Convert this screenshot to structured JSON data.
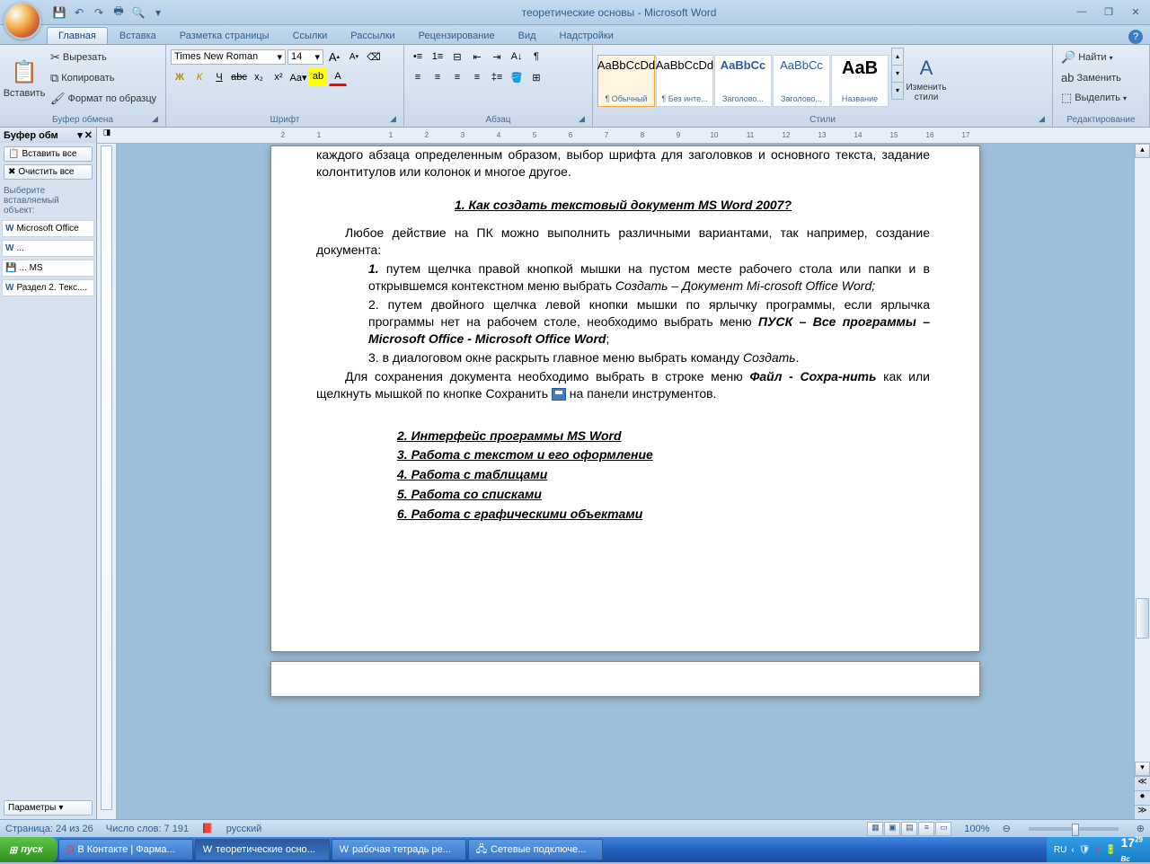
{
  "title": "теоретические основы - Microsoft Word",
  "tabs": [
    "Главная",
    "Вставка",
    "Разметка страницы",
    "Ссылки",
    "Рассылки",
    "Рецензирование",
    "Вид",
    "Надстройки"
  ],
  "ribbon": {
    "clipboard": {
      "paste": "Вставить",
      "cut": "Вырезать",
      "copy": "Копировать",
      "painter": "Формат по образцу",
      "label": "Буфер обмена"
    },
    "font": {
      "name": "Times New Roman",
      "size": "14",
      "label": "Шрифт"
    },
    "paragraph": {
      "label": "Абзац"
    },
    "styles": {
      "label": "Стили",
      "change": "Изменить стили",
      "items": [
        {
          "sample": "AaBbCcDd",
          "name": "¶ Обычный"
        },
        {
          "sample": "AaBbCcDd",
          "name": "¶ Без инте..."
        },
        {
          "sample": "AaBbCc",
          "name": "Заголово...",
          "color": "#2a5a9a",
          "bold": true
        },
        {
          "sample": "AaBbCc",
          "name": "Заголово...",
          "color": "#2a5a9a"
        },
        {
          "sample": "АаВ",
          "name": "Название",
          "bold": true,
          "big": true
        }
      ]
    },
    "editing": {
      "find": "Найти",
      "replace": "Заменить",
      "select": "Выделить",
      "label": "Редактирование"
    }
  },
  "clipboardPane": {
    "title": "Буфер обм",
    "pasteAll": "Вставить все",
    "clearAll": "Очистить все",
    "hint": "Выберите вставляемый объект:",
    "options": "Параметры",
    "items": [
      {
        "icon": "W",
        "text": "Microsoft Office"
      },
      {
        "icon": "W",
        "text": "..."
      },
      {
        "icon": "💾",
        "text": "... MS"
      },
      {
        "icon": "W",
        "text": "Раздел 2. Текс...."
      }
    ]
  },
  "document": {
    "topPara": "каждого абзаца определенным образом, выбор шрифта для заголовков и основного текста, задание колонтитулов или колонок и многое другое.",
    "h1": "1.  Как создать текстовый документ MS Word 2007?",
    "intro": "Любое действие на ПК можно выполнить различными вариантами, так например, создание документа:",
    "li1a": "путем щелчка правой кнопкой мышки на пустом месте рабочего стола или папки и в открывшемся контекстном меню выбрать",
    "li1b": "Создать – Документ Mi-crosoft  Office Word;",
    "li2a": "путем двойного щелчка левой кнопки мышки по ярлычку программы, если ярлычка программы нет на рабочем столе, необходимо выбрать меню ",
    "li2b": "ПУСК – Все программы – Microsoft  Office - Microsoft  Office Word",
    "li3a": "в диалоговом окне раскрыть главное меню  выбрать команду ",
    "li3b": "Создать",
    "save1": "Для сохранения документа необходимо выбрать в строке меню ",
    "save2": "Файл - Сохра-нить",
    "save3": " как или щелкнуть мышкой по кнопке Сохранить ",
    "save4": " на панели инструментов.",
    "h2": "2.  Интерфейс программы MS Word",
    "h3": "3.  Работа с текстом и его оформление",
    "h4": "4.  Работа с таблицами",
    "h5": "5.  Работа со списками",
    "h6": "6.  Работа с графическими объектами"
  },
  "statusbar": {
    "page": "Страница: 24 из 26",
    "words": "Число слов: 7 191",
    "lang": "русский",
    "zoom": "100%"
  },
  "taskbar": {
    "start": "пуск",
    "items": [
      "В Контакте | Фарма...",
      "теоретические осно...",
      "рабочая тетрадь ре...",
      "Сетевые подключе..."
    ],
    "lang": "RU",
    "time": "17",
    "min": "29",
    "day": "Вс"
  },
  "ruler": [
    "2",
    "1",
    "",
    "1",
    "2",
    "3",
    "4",
    "5",
    "6",
    "7",
    "8",
    "9",
    "10",
    "11",
    "12",
    "13",
    "14",
    "15",
    "16",
    "17"
  ]
}
